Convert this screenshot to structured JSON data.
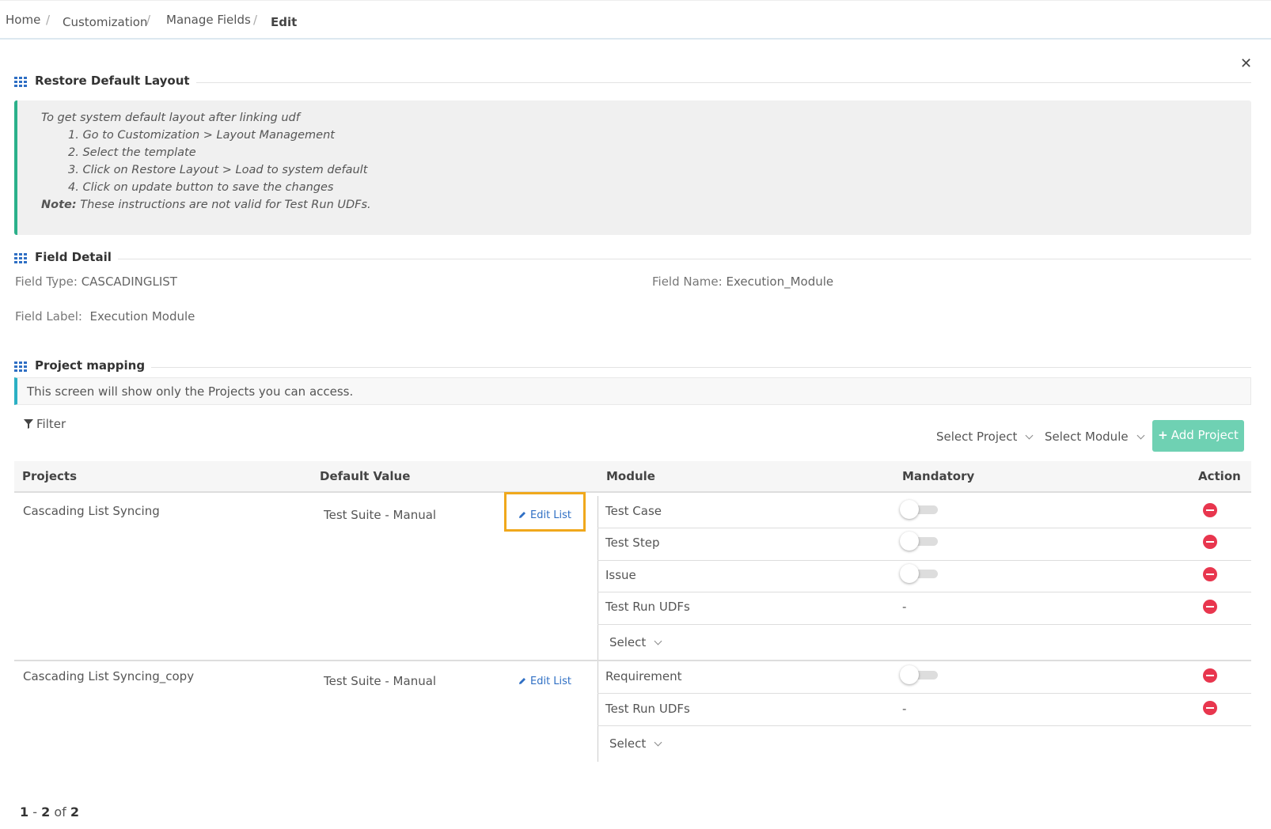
{
  "breadcrumb": [
    "Home",
    "Customization",
    "Manage Fields",
    "Edit"
  ],
  "restore_section": {
    "title": "Restore Default Layout",
    "intro": "To get system default layout after linking udf",
    "steps": [
      "1. Go to Customization > Layout Management",
      "2. Select the template",
      "3. Click on Restore Layout > Load to system default",
      "4. Click on update button to save the changes"
    ],
    "note_label": "Note:",
    "note_text": "These instructions are not valid for Test Run UDFs."
  },
  "field_detail": {
    "title": "Field Detail",
    "type_label": "Field Type:",
    "type_value": "CASCADINGLIST",
    "name_label": "Field Name:",
    "name_value": "Execution_Module",
    "label_label": "Field Label:",
    "label_value": "Execution Module"
  },
  "project_mapping": {
    "title": "Project mapping",
    "info": "This screen will show only the Projects you can access.",
    "filter_label": "Filter",
    "select_project": "Select Project",
    "select_module": "Select Module",
    "add_project": "Add Project",
    "columns": [
      "Projects",
      "Default Value",
      "Module",
      "Mandatory",
      "Action"
    ],
    "edit_list_label": "Edit List",
    "select_label": "Select",
    "rows": [
      {
        "project": "Cascading List Syncing",
        "default_value": "Test Suite - Manual",
        "modules": [
          {
            "name": "Test Case",
            "mandatory": "off"
          },
          {
            "name": "Test Step",
            "mandatory": "off"
          },
          {
            "name": "Issue",
            "mandatory": "off"
          },
          {
            "name": "Test Run UDFs",
            "mandatory": "-"
          }
        ]
      },
      {
        "project": "Cascading List Syncing_copy",
        "default_value": "Test Suite - Manual",
        "modules": [
          {
            "name": "Requirement",
            "mandatory": "off"
          },
          {
            "name": "Test Run UDFs",
            "mandatory": "-"
          }
        ]
      }
    ]
  },
  "pagination": {
    "start": "1",
    "end": "2",
    "of_label": "of",
    "total": "2"
  },
  "colors": {
    "accent": "#2bb08a",
    "info": "#2bb0c4",
    "add_button": "#6fd1b3",
    "remove": "#e8364e",
    "link": "#2f6fc4",
    "highlight": "#f0a81c"
  }
}
